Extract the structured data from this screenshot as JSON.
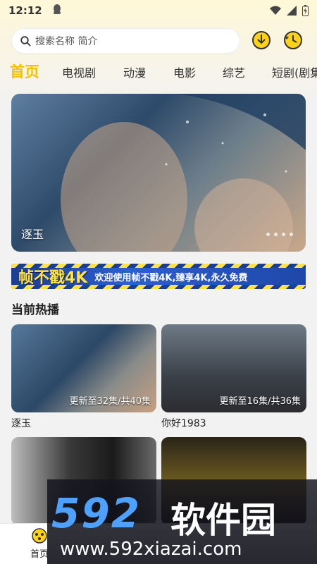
{
  "status_bar": {
    "time": "12:12"
  },
  "search": {
    "placeholder": "搜索名称 简介"
  },
  "tabs": [
    {
      "label": "首页",
      "active": true
    },
    {
      "label": "电视剧"
    },
    {
      "label": "动漫"
    },
    {
      "label": "电影"
    },
    {
      "label": "综艺"
    },
    {
      "label": "短剧(剧集"
    }
  ],
  "banner": {
    "title": "逐玉",
    "dots": 4
  },
  "ad": {
    "logo": "帧不戳4K",
    "text": "欢迎使用帧不戳4K,臻享4K,永久免费"
  },
  "section": {
    "title": "当前热播"
  },
  "cards": [
    {
      "name": "逐玉",
      "update": "更新至32集/共40集"
    },
    {
      "name": "你好1983",
      "update": "更新至16集/共36集"
    },
    {
      "name": "",
      "update": ""
    },
    {
      "name": "",
      "update": ""
    }
  ],
  "bottom_nav": {
    "home": "首页"
  },
  "watermark": {
    "number": "592",
    "chinese": "软件园",
    "url": "www.592xiazai.com"
  },
  "colors": {
    "accent": "#f2c200",
    "watermark_blue": "#4ea1ff"
  }
}
